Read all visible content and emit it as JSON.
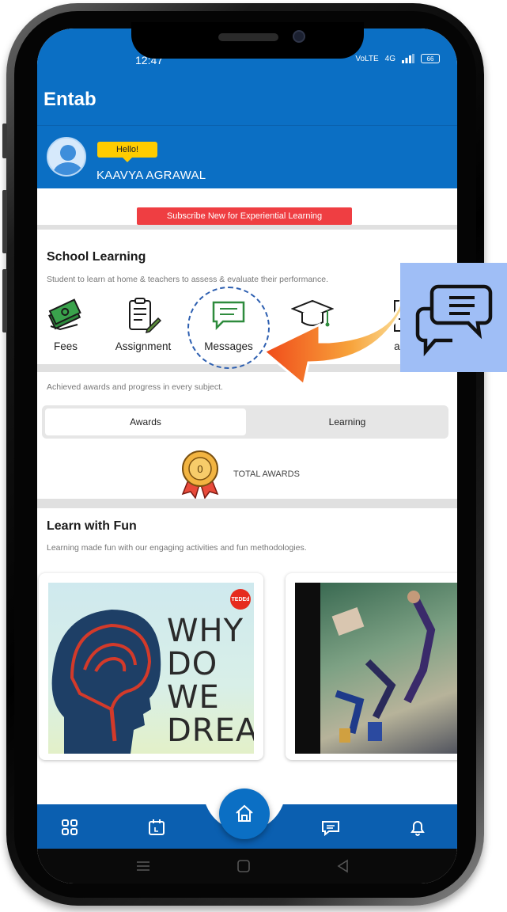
{
  "status_bar": {
    "time": "12:47",
    "network": "4G",
    "volte": "VoLTE",
    "battery": "66"
  },
  "header": {
    "app_title": "Entab"
  },
  "user": {
    "greeting": "Hello!",
    "name": "KAAVYA AGRAWAL"
  },
  "subscribe": {
    "label": "Subscribe New for Experiential Learning"
  },
  "school_learning": {
    "title": "School Learning",
    "subtitle": "Student to learn at home & teachers to assess & evaluate their performance.",
    "tiles": [
      {
        "label": "Fees",
        "icon": "money-icon"
      },
      {
        "label": "Assignment",
        "icon": "assignment-icon"
      },
      {
        "label": "Messages",
        "icon": "chat-icon"
      },
      {
        "label": "",
        "icon": "graduation-cap-icon"
      },
      {
        "label": "ans",
        "icon": "document-icon"
      }
    ]
  },
  "awards": {
    "subtitle": "Achieved awards and progress in every subject.",
    "tabs": [
      "Awards",
      "Learning"
    ],
    "count": "0",
    "total_label": "TOTAL AWARDS"
  },
  "learn_fun": {
    "title": "Learn with Fun",
    "subtitle": "Learning made fun with our engaging activities and fun methodologies.",
    "videos": [
      {
        "badge": "TEDEd",
        "art_text": "WHY DO WE DREAM?"
      },
      {
        "badge": "",
        "art_text": ""
      }
    ]
  },
  "bottom_nav": [
    "dashboard-icon",
    "calendar-icon",
    "home-icon",
    "chat-icon",
    "bell-icon"
  ],
  "colors": {
    "primary": "#0b6fc4",
    "accent_red": "#ef3e42",
    "badge_yellow": "#ffcc00",
    "callout_bg": "#9fbef6"
  }
}
